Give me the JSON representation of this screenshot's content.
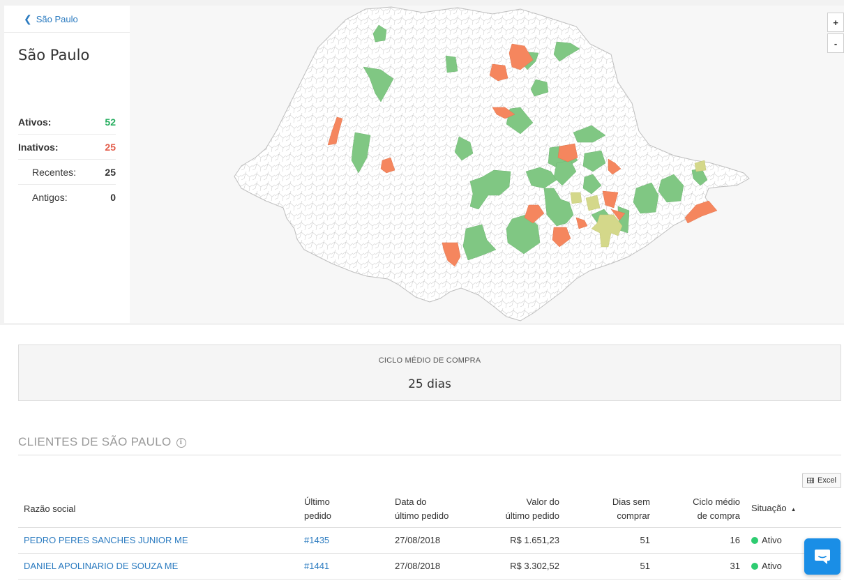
{
  "sidebar": {
    "back_label": "São Paulo",
    "title": "São Paulo",
    "stats": [
      {
        "label": "Ativos:",
        "value": "52",
        "style": "bold",
        "color": "#27ae60"
      },
      {
        "label": "Inativos:",
        "value": "25",
        "style": "bold",
        "color": "#e35d4b"
      },
      {
        "label": "Recentes:",
        "value": "25",
        "style": "sub"
      },
      {
        "label": "Antigos:",
        "value": "0",
        "style": "sub"
      }
    ]
  },
  "map": {
    "zoom_in_label": "+",
    "zoom_out_label": "-",
    "colors": {
      "ativo": "#80c783",
      "inativo": "#f5865e",
      "recente": "#d4d88a",
      "neutral": "#ffffff",
      "border": "#c9c9c9"
    }
  },
  "summary_card": {
    "label": "CICLO MÉDIO DE COMPRA",
    "value": "25 dias"
  },
  "clients_section": {
    "title": "CLIENTES DE SÃO PAULO",
    "info_icon": "info-icon",
    "excel_label": "Excel",
    "columns": {
      "razao_social": "Razão social",
      "ultimo_pedido_1": "Último",
      "ultimo_pedido_2": "pedido",
      "data_1": "Data do",
      "data_2": "último pedido",
      "valor_1": "Valor do",
      "valor_2": "último pedido",
      "dias_1": "Dias sem",
      "dias_2": "comprar",
      "ciclo_1": "Ciclo médio",
      "ciclo_2": "de compra",
      "situacao": "Situação"
    },
    "rows": [
      {
        "razao_social": "PEDRO PERES SANCHES JUNIOR ME",
        "pedido": "#1435",
        "data": "27/08/2018",
        "valor": "R$ 1.651,23",
        "dias": "51",
        "ciclo": "16",
        "situacao": "Ativo"
      },
      {
        "razao_social": "DANIEL APOLINARIO DE SOUZA ME",
        "pedido": "#1441",
        "data": "27/08/2018",
        "valor": "R$ 3.302,52",
        "dias": "51",
        "ciclo": "31",
        "situacao": "Ativo"
      }
    ]
  }
}
